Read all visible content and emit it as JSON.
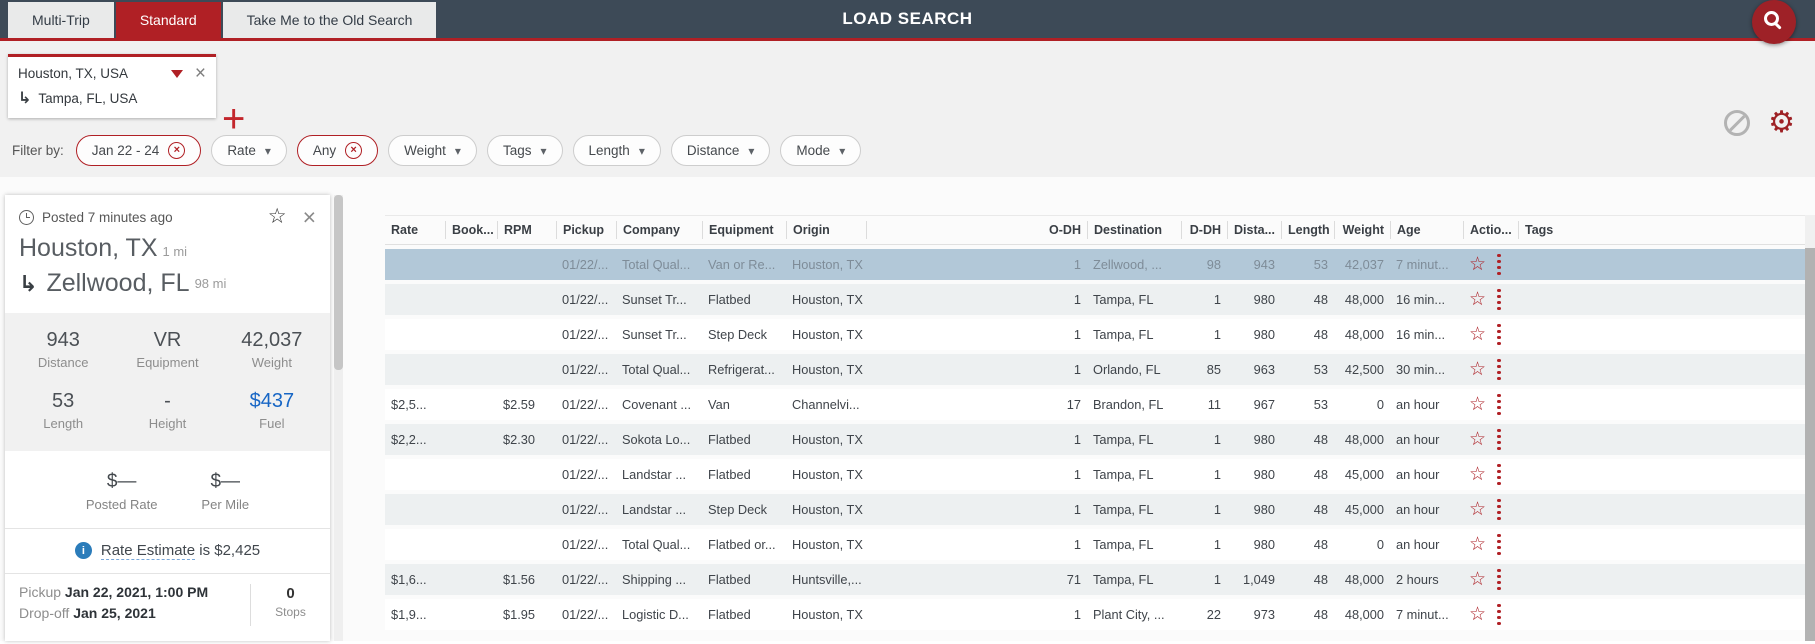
{
  "topbar": {
    "title": "LOAD SEARCH",
    "tabs": [
      {
        "label": "Multi-Trip"
      },
      {
        "label": "Standard",
        "active": true
      },
      {
        "label": "Take Me to the Old Search"
      }
    ]
  },
  "trip": {
    "origin": "Houston, TX, USA",
    "destination": "Tampa, FL, USA"
  },
  "filters": {
    "label": "Filter by:",
    "pills": [
      {
        "label": "Jan 22 - 24",
        "type": "clearable"
      },
      {
        "label": "Rate",
        "type": "dropdown"
      },
      {
        "label": "Any",
        "type": "clearable"
      },
      {
        "label": "Weight",
        "type": "dropdown"
      },
      {
        "label": "Tags",
        "type": "dropdown"
      },
      {
        "label": "Length",
        "type": "dropdown"
      },
      {
        "label": "Distance",
        "type": "dropdown"
      },
      {
        "label": "Mode",
        "type": "dropdown"
      }
    ]
  },
  "detail": {
    "posted": "Posted 7 minutes ago",
    "origin_city": "Houston, TX",
    "origin_distance": "1 mi",
    "destination_city": "Zellwood, FL",
    "destination_distance": "98 mi",
    "stats": [
      {
        "value": "943",
        "label": "Distance"
      },
      {
        "value": "VR",
        "label": "Equipment"
      },
      {
        "value": "42,037",
        "label": "Weight"
      },
      {
        "value": "53",
        "label": "Length"
      },
      {
        "value": "-",
        "label": "Height"
      },
      {
        "value": "$437",
        "label": "Fuel",
        "highlight": true
      }
    ],
    "rates": [
      {
        "value": "$—",
        "label": "Posted Rate"
      },
      {
        "value": "$—",
        "label": "Per Mile"
      }
    ],
    "rate_estimate": {
      "link": "Rate Estimate",
      "rest": " is $2,425"
    },
    "schedule": {
      "pickup_label": "Pickup",
      "pickup_value": "Jan 22, 2021, 1:00 PM",
      "dropoff_label": "Drop-off",
      "dropoff_value": "Jan 25, 2021",
      "stops_value": "0",
      "stops_label": "Stops"
    }
  },
  "table": {
    "columns": [
      {
        "label": "Rate"
      },
      {
        "label": "Book..."
      },
      {
        "label": "RPM"
      },
      {
        "label": "Pickup"
      },
      {
        "label": "Company"
      },
      {
        "label": "Equipment"
      },
      {
        "label": "Origin"
      },
      {
        "label": "O-DH",
        "align": "right"
      },
      {
        "label": "Destination"
      },
      {
        "label": "D-DH",
        "align": "right"
      },
      {
        "label": "Dista...",
        "align": "right"
      },
      {
        "label": "Length",
        "align": "right"
      },
      {
        "label": "Weight",
        "align": "right"
      },
      {
        "label": "Age"
      },
      {
        "label": "Actio..."
      },
      {
        "label": "Tags"
      }
    ],
    "rows": [
      {
        "selected": true,
        "rate": "",
        "book": "",
        "rpm": "",
        "pickup": "01/22/...",
        "company": "Total Qual...",
        "equipment": "Van or Re...",
        "origin": "Houston, TX",
        "odh": "1",
        "destination": "Zellwood, ...",
        "ddh": "98",
        "distance": "943",
        "length": "53",
        "weight": "42,037",
        "age": "7 minut..."
      },
      {
        "rate": "",
        "book": "",
        "rpm": "",
        "pickup": "01/22/...",
        "company": "Sunset Tr...",
        "equipment": "Flatbed",
        "origin": "Houston, TX",
        "odh": "1",
        "destination": "Tampa, FL",
        "ddh": "1",
        "distance": "980",
        "length": "48",
        "weight": "48,000",
        "age": "16 min..."
      },
      {
        "rate": "",
        "book": "",
        "rpm": "",
        "pickup": "01/22/...",
        "company": "Sunset Tr...",
        "equipment": "Step Deck",
        "origin": "Houston, TX",
        "odh": "1",
        "destination": "Tampa, FL",
        "ddh": "1",
        "distance": "980",
        "length": "48",
        "weight": "48,000",
        "age": "16 min..."
      },
      {
        "rate": "",
        "book": "",
        "rpm": "",
        "pickup": "01/22/...",
        "company": "Total Qual...",
        "equipment": "Refrigerat...",
        "origin": "Houston, TX",
        "odh": "1",
        "destination": "Orlando, FL",
        "ddh": "85",
        "distance": "963",
        "length": "53",
        "weight": "42,500",
        "age": "30 min..."
      },
      {
        "rate": "$2,5...",
        "book": "",
        "rpm": "$2.59",
        "pickup": "01/22/...",
        "company": "Covenant ...",
        "equipment": "Van",
        "origin": "Channelvi...",
        "odh": "17",
        "destination": "Brandon, FL",
        "ddh": "11",
        "distance": "967",
        "length": "53",
        "weight": "0",
        "age": "an hour"
      },
      {
        "rate": "$2,2...",
        "book": "",
        "rpm": "$2.30",
        "pickup": "01/22/...",
        "company": "Sokota Lo...",
        "equipment": "Flatbed",
        "origin": "Houston, TX",
        "odh": "1",
        "destination": "Tampa, FL",
        "ddh": "1",
        "distance": "980",
        "length": "48",
        "weight": "48,000",
        "age": "an hour"
      },
      {
        "rate": "",
        "book": "",
        "rpm": "",
        "pickup": "01/22/...",
        "company": "Landstar ...",
        "equipment": "Flatbed",
        "origin": "Houston, TX",
        "odh": "1",
        "destination": "Tampa, FL",
        "ddh": "1",
        "distance": "980",
        "length": "48",
        "weight": "45,000",
        "age": "an hour"
      },
      {
        "rate": "",
        "book": "",
        "rpm": "",
        "pickup": "01/22/...",
        "company": "Landstar ...",
        "equipment": "Step Deck",
        "origin": "Houston, TX",
        "odh": "1",
        "destination": "Tampa, FL",
        "ddh": "1",
        "distance": "980",
        "length": "48",
        "weight": "45,000",
        "age": "an hour"
      },
      {
        "rate": "",
        "book": "",
        "rpm": "",
        "pickup": "01/22/...",
        "company": "Total Qual...",
        "equipment": "Flatbed or...",
        "origin": "Houston, TX",
        "odh": "1",
        "destination": "Tampa, FL",
        "ddh": "1",
        "distance": "980",
        "length": "48",
        "weight": "0",
        "age": "an hour"
      },
      {
        "rate": "$1,6...",
        "book": "",
        "rpm": "$1.56",
        "pickup": "01/22/...",
        "company": "Shipping ...",
        "equipment": "Flatbed",
        "origin": "Huntsville,...",
        "odh": "71",
        "destination": "Tampa, FL",
        "ddh": "1",
        "distance": "1,049",
        "length": "48",
        "weight": "48,000",
        "age": "2 hours"
      },
      {
        "rate": "$1,9...",
        "book": "",
        "rpm": "$1.95",
        "pickup": "01/22/...",
        "company": "Logistic D...",
        "equipment": "Flatbed",
        "origin": "Houston, TX",
        "odh": "1",
        "destination": "Plant City, ...",
        "ddh": "22",
        "distance": "973",
        "length": "48",
        "weight": "48,000",
        "age": "7 minut..."
      }
    ]
  },
  "colors": {
    "accent_red": "#b02025",
    "header_navy": "#3d4a57",
    "selected_row": "#b2c8d8",
    "fuel_blue": "#1766c5",
    "info_blue": "#2b7cba"
  }
}
